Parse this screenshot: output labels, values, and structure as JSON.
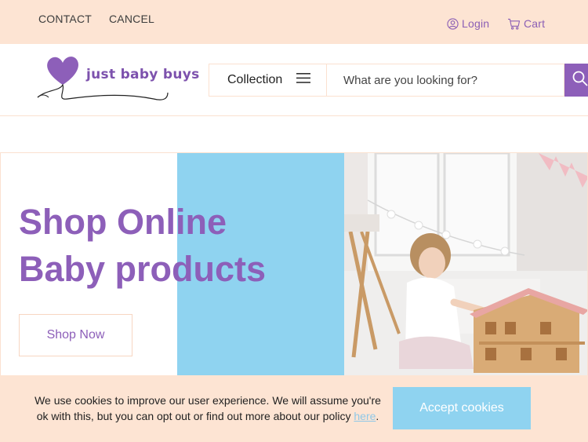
{
  "topbar": {
    "contact_label": "CONTACT",
    "cancel_label": "CANCEL",
    "login_label": "Login",
    "cart_label": "Cart"
  },
  "header": {
    "logo_text": "just baby buys",
    "collection_label": "Collection",
    "search": {
      "placeholder": "What are you looking for?",
      "value": ""
    }
  },
  "hero": {
    "headline": "Shop Online\nBaby products",
    "cta_label": "Shop Now"
  },
  "cookie_banner": {
    "message": "We use cookies to improve our user experience. We will assume you're ok with this, but you can opt out or find out more about our policy ",
    "link_label": "here",
    "trailing": ".",
    "accept_label": "Accept cookies"
  },
  "colors": {
    "brand_purple": "#8d5fb9",
    "peach": "#fde4d3",
    "sky_blue": "#8fd3f0"
  },
  "icons": [
    "user-circle-icon",
    "cart-icon",
    "hamburger-icon",
    "search-icon",
    "heart-logo-icon"
  ]
}
